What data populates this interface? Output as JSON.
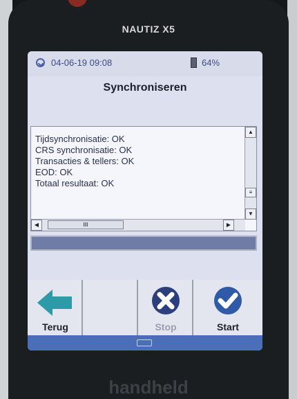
{
  "device": {
    "brand": "NAUTIZ X5",
    "footer_brand": "handheld"
  },
  "status": {
    "datetime": "04-06-19 09:08",
    "battery": "64%"
  },
  "screen": {
    "title": "Synchroniseren"
  },
  "log_lines": [
    "Tijdsynchronisatie: OK",
    "CRS synchronisatie: OK",
    "Transacties & tellers: OK",
    "EOD: OK",
    "Totaal resultaat: OK"
  ],
  "scrollbar": {
    "up": "▲",
    "down": "▼",
    "left": "◀",
    "right": "▶",
    "grip": "III"
  },
  "progress": {
    "fraction": 1.0
  },
  "toolbar": {
    "back_label": "Terug",
    "empty_label": "",
    "stop_label": "Stop",
    "start_label": "Start"
  },
  "icons": [
    "clock-icon",
    "battery-icon",
    "back-arrow-icon",
    "stop-x-icon",
    "start-check-icon",
    "keyboard-icon"
  ],
  "colors": {
    "accent": "#4a6fb8",
    "check_blue": "#2f5aa8",
    "arrow_teal": "#2d9aa8"
  }
}
